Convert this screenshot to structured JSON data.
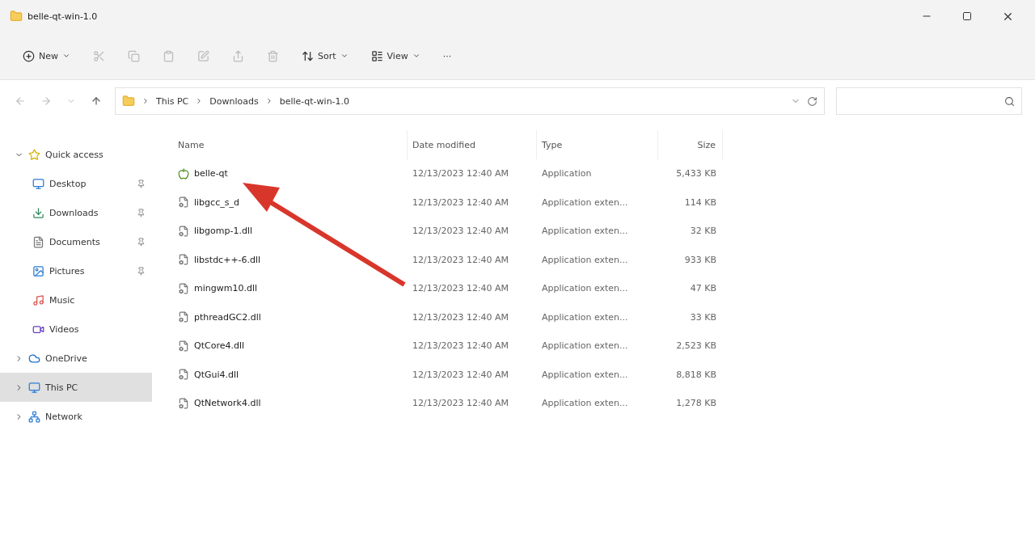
{
  "window": {
    "title": "belle-qt-win-1.0"
  },
  "toolbar": [
    {
      "kind": "new",
      "label": "New"
    },
    {
      "kind": "cut"
    },
    {
      "kind": "copy"
    },
    {
      "kind": "paste"
    },
    {
      "kind": "rename"
    },
    {
      "kind": "share"
    },
    {
      "kind": "delete"
    },
    {
      "kind": "sort",
      "label": "Sort"
    },
    {
      "kind": "view",
      "label": "View"
    },
    {
      "kind": "more",
      "label": "···"
    }
  ],
  "breadcrumb": [
    "This PC",
    "Downloads",
    "belle-qt-win-1.0"
  ],
  "sidebar": {
    "items": [
      {
        "label": "Quick access",
        "kind": "star",
        "expanded": true,
        "selected": false,
        "children": [
          {
            "label": "Desktop",
            "kind": "desktop",
            "pinned": true,
            "selected": false
          },
          {
            "label": "Downloads",
            "kind": "download",
            "pinned": true,
            "selected": false
          },
          {
            "label": "Documents",
            "kind": "document",
            "pinned": true,
            "selected": false
          },
          {
            "label": "Pictures",
            "kind": "picture",
            "pinned": true,
            "selected": false
          },
          {
            "label": "Music",
            "kind": "music",
            "pinned": false,
            "selected": false
          },
          {
            "label": "Videos",
            "kind": "video",
            "pinned": false,
            "selected": false
          }
        ]
      },
      {
        "label": "OneDrive",
        "kind": "cloud",
        "expanded": false,
        "selected": false
      },
      {
        "label": "This PC",
        "kind": "pc",
        "expanded": false,
        "selected": true
      },
      {
        "label": "Network",
        "kind": "network",
        "expanded": false,
        "selected": false
      }
    ]
  },
  "table": {
    "columns": [
      "Name",
      "Date modified",
      "Type",
      "Size"
    ],
    "rows": [
      {
        "kind": "app",
        "name": "belle-qt",
        "date": "12/13/2023 12:40 AM",
        "type": "Application",
        "size": "5,433 KB"
      },
      {
        "kind": "dll",
        "name": "libgcc_s_d",
        "date": "12/13/2023 12:40 AM",
        "type": "Application exten...",
        "size": "114 KB"
      },
      {
        "kind": "dll",
        "name": "libgomp-1.dll",
        "date": "12/13/2023 12:40 AM",
        "type": "Application exten...",
        "size": "32 KB"
      },
      {
        "kind": "dll",
        "name": "libstdc++-6.dll",
        "date": "12/13/2023 12:40 AM",
        "type": "Application exten...",
        "size": "933 KB"
      },
      {
        "kind": "dll",
        "name": "mingwm10.dll",
        "date": "12/13/2023 12:40 AM",
        "type": "Application exten...",
        "size": "47 KB"
      },
      {
        "kind": "dll",
        "name": "pthreadGC2.dll",
        "date": "12/13/2023 12:40 AM",
        "type": "Application exten...",
        "size": "33 KB"
      },
      {
        "kind": "dll",
        "name": "QtCore4.dll",
        "date": "12/13/2023 12:40 AM",
        "type": "Application exten...",
        "size": "2,523 KB"
      },
      {
        "kind": "dll",
        "name": "QtGui4.dll",
        "date": "12/13/2023 12:40 AM",
        "type": "Application exten...",
        "size": "8,818 KB"
      },
      {
        "kind": "dll",
        "name": "QtNetwork4.dll",
        "date": "12/13/2023 12:40 AM",
        "type": "Application exten...",
        "size": "1,278 KB"
      }
    ]
  }
}
